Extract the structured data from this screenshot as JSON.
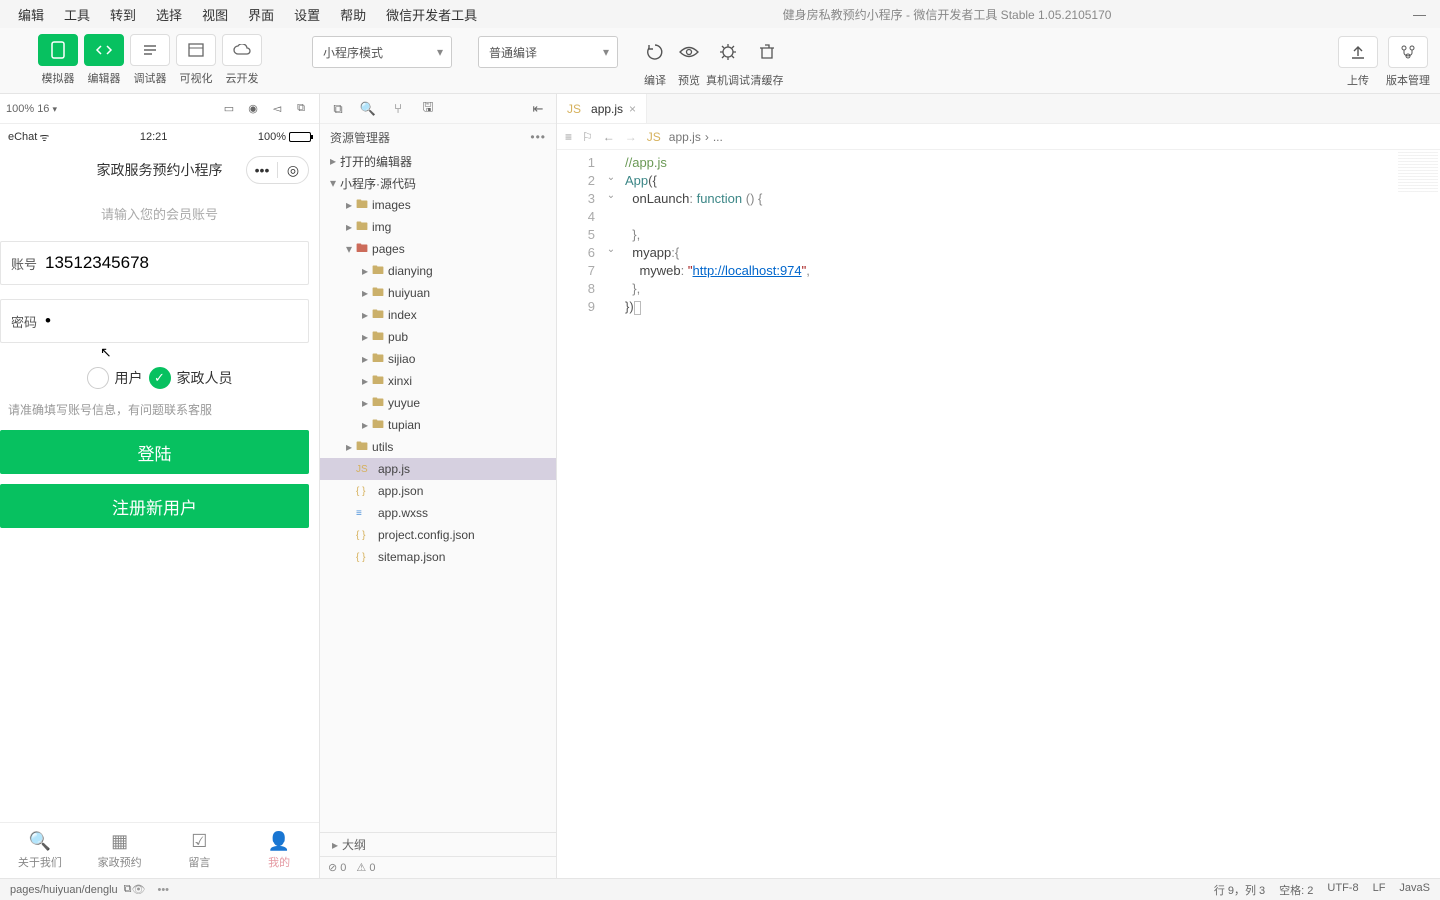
{
  "window": {
    "title_project": "健身房私教预约小程序",
    "title_suffix": " - 微信开发者工具 Stable 1.05.2105170"
  },
  "menubar": [
    "编辑",
    "工具",
    "转到",
    "选择",
    "视图",
    "界面",
    "设置",
    "帮助",
    "微信开发者工具"
  ],
  "toolbar": {
    "mode_labels": [
      "模拟器",
      "编辑器",
      "调试器",
      "可视化",
      "云开发"
    ],
    "select_mode": "小程序模式",
    "select_compile": "普通编译",
    "action_labels": [
      "编译",
      "预览",
      "真机调试",
      "清缓存"
    ],
    "right_labels": [
      "上传",
      "版本管理"
    ]
  },
  "simulator": {
    "zoom": "100% 16",
    "status": {
      "carrier": "eChat",
      "time": "12:21",
      "battery": "100%"
    },
    "nav_title": "家政服务预约小程序",
    "login": {
      "subtitle": "请输入您的会员账号",
      "account_label": "账号",
      "account_value": "13512345678",
      "password_label": "密码",
      "password_value": "•",
      "radio_user": "用户",
      "radio_staff": "家政人员",
      "hint": "请准确填写账号信息，有问题联系客服",
      "btn_login": "登陆",
      "btn_register": "注册新用户"
    },
    "tabbar": [
      "关于我们",
      "家政预约",
      "留言",
      "我的"
    ]
  },
  "explorer": {
    "title": "资源管理器",
    "sections": {
      "opened": "打开的编辑器",
      "project": "小程序·源代码"
    },
    "tree": {
      "folders_top": [
        "images",
        "img"
      ],
      "pages_folder": "pages",
      "pages_children": [
        "dianying",
        "huiyuan",
        "index",
        "pub",
        "sijiao",
        "xinxi",
        "yuyue",
        "tupian"
      ],
      "utils_folder": "utils",
      "root_files": [
        {
          "name": "app.js",
          "type": "js",
          "selected": true
        },
        {
          "name": "app.json",
          "type": "json"
        },
        {
          "name": "app.wxss",
          "type": "wxss"
        },
        {
          "name": "project.config.json",
          "type": "json"
        },
        {
          "name": "sitemap.json",
          "type": "json"
        }
      ]
    },
    "outline": "大纲"
  },
  "editor": {
    "tab_name": "app.js",
    "breadcrumb_file": "app.js",
    "breadcrumb_sep": "›",
    "breadcrumb_more": "...",
    "code_lines": [
      {
        "n": 1,
        "type": "comment",
        "text": "//app.js"
      },
      {
        "n": 2,
        "type": "app",
        "key": "App",
        "brace": "({"
      },
      {
        "n": 3,
        "type": "func",
        "prop": "onLaunch",
        "kw": "function",
        "rest": " () {"
      },
      {
        "n": 4,
        "type": "blank"
      },
      {
        "n": 5,
        "type": "close",
        "text": "},"
      },
      {
        "n": 6,
        "type": "obj",
        "prop": "myapp",
        "rest": ":{"
      },
      {
        "n": 7,
        "type": "kv",
        "prop": "myweb",
        "val": "\"http://localhost:974\"",
        "tail": ","
      },
      {
        "n": 8,
        "type": "close",
        "text": "},"
      },
      {
        "n": 9,
        "type": "end",
        "text": "})"
      }
    ],
    "footer": {
      "errors": "0",
      "warnings": "0"
    }
  },
  "statusbar": {
    "path": "pages/huiyuan/denglu",
    "cursor": "行 9，列 3",
    "spaces": "空格: 2",
    "encoding": "UTF-8",
    "eol": "LF",
    "lang": "JavaS"
  }
}
